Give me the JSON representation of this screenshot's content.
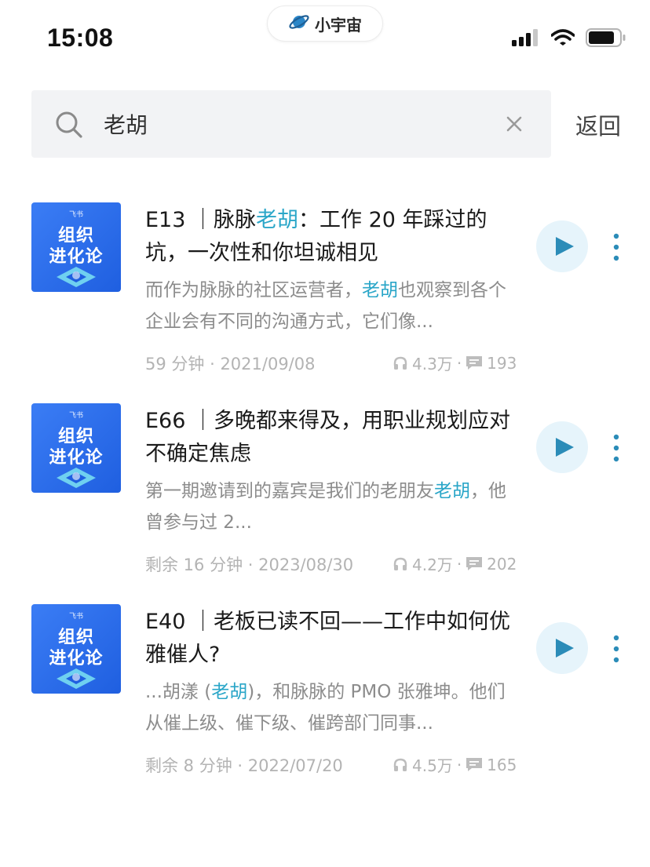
{
  "status_bar": {
    "time": "15:08",
    "app_name": "小宇宙",
    "icons": [
      "signal-icon",
      "wifi-icon",
      "battery-icon"
    ]
  },
  "search": {
    "value": "老胡",
    "placeholder": "",
    "back_label": "返回"
  },
  "colors": {
    "highlight": "#2aa6c8",
    "play_bg": "#e6f4fb",
    "play_icon": "#2b8cb8",
    "cover_blue": "#2a6ef0"
  },
  "results": [
    {
      "cover": {
        "brand": "飞书",
        "line1": "组织",
        "line2": "进化论"
      },
      "title_parts": [
        "E13 ｜脉脉",
        "老胡",
        "：工作 20 年踩过的坑，一次性和你坦诚相见"
      ],
      "desc_parts": [
        "而作为脉脉的社区运营者，",
        "老胡",
        "也观察到各个企业会有不同的沟通方式，它们像..."
      ],
      "duration": "59 分钟",
      "date": "2021/09/08",
      "plays": "4.3万",
      "comments": "193"
    },
    {
      "cover": {
        "brand": "飞书",
        "line1": "组织",
        "line2": "进化论"
      },
      "title_parts": [
        "E66 ｜多晚都来得及，用职业规划应对不确定焦虑",
        "",
        ""
      ],
      "desc_parts": [
        "第一期邀请到的嘉宾是我们的老朋友",
        "老胡",
        "，他曾参与过 2..."
      ],
      "duration": "剩余 16 分钟",
      "date": "2023/08/30",
      "plays": "4.2万",
      "comments": "202"
    },
    {
      "cover": {
        "brand": "飞书",
        "line1": "组织",
        "line2": "进化论"
      },
      "title_parts": [
        "E40 ｜老板已读不回——工作中如何优雅催人?",
        "",
        ""
      ],
      "desc_parts": [
        "...胡漾 (",
        "老胡",
        ")，和脉脉的 PMO 张雅坤。他们从催上级、催下级、催跨部门同事..."
      ],
      "duration": "剩余 8 分钟",
      "date": "2022/07/20",
      "plays": "4.5万",
      "comments": "165"
    }
  ]
}
